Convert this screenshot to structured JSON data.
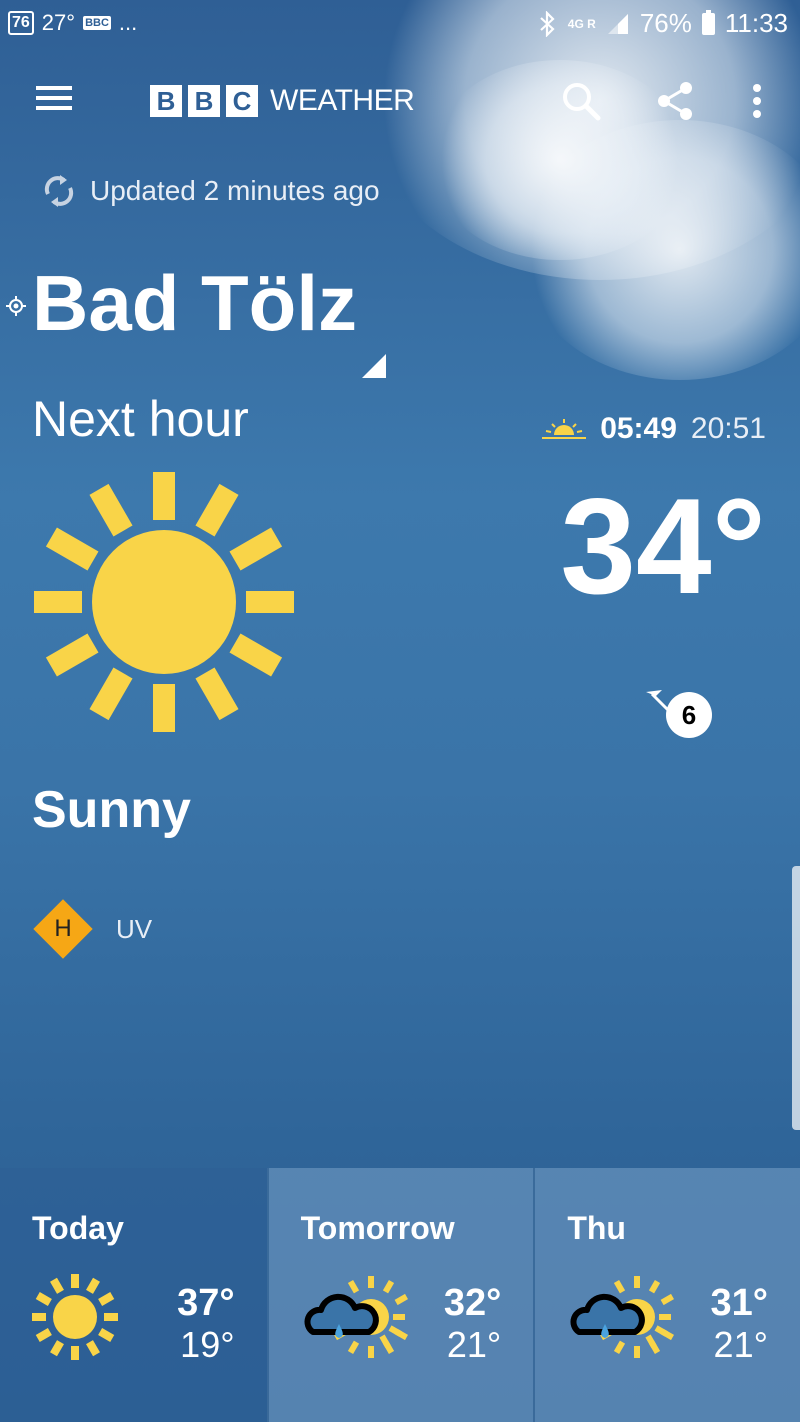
{
  "status_bar": {
    "notif_number": "76",
    "notif_temp": "27°",
    "notif_app": "BBC",
    "more": "...",
    "network_top": "4G",
    "network_r": "R",
    "battery": "76%",
    "time": "11:33"
  },
  "app_bar": {
    "logo_letters": [
      "B",
      "B",
      "C"
    ],
    "logo_word": "WEATHER",
    "icons": [
      "menu-icon",
      "search-icon",
      "share-icon",
      "more-vert-icon"
    ]
  },
  "updated_text": "Updated 2 minutes ago",
  "location": {
    "name": "Bad Tölz"
  },
  "current": {
    "period_label": "Next hour",
    "sunrise": "05:49",
    "sunset": "20:51",
    "temperature": "34°",
    "wind_speed": "6",
    "condition": "Sunny",
    "uv_level": "H",
    "uv_label": "UV"
  },
  "forecast": [
    {
      "day": "Today",
      "icon": "sunny-icon",
      "high": "37°",
      "low": "19°"
    },
    {
      "day": "Tomorrow",
      "icon": "light-rain-sun-icon",
      "high": "32°",
      "low": "21°"
    },
    {
      "day": "Thu",
      "icon": "light-rain-sun-icon",
      "high": "31°",
      "low": "21°"
    }
  ],
  "colors": {
    "sun": "#f9d448",
    "uv_high": "#f6a715",
    "sky_top": "#2f5f95"
  }
}
